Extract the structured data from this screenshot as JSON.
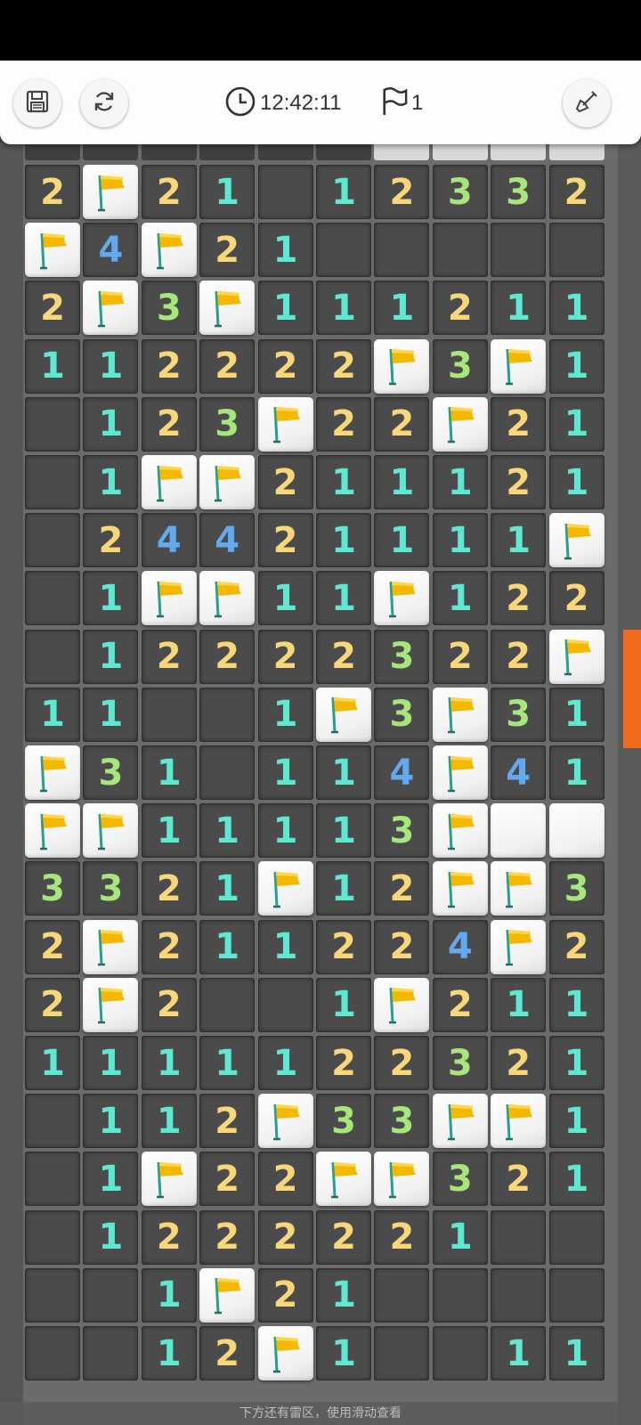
{
  "toolbar": {
    "timer": "12:42:11",
    "flag_count": "1",
    "icons": [
      "save-icon",
      "refresh-icon",
      "clock-icon",
      "flag-outline-icon",
      "shovel-icon"
    ]
  },
  "hint": "下方还有雷区，使用滑动查看",
  "colors": {
    "n1": "#5ee8d2",
    "n2": "#f7d77a",
    "n3": "#a6e67a",
    "n4": "#63a9ee",
    "flag": "#f5b800",
    "scroll_thumb": "#f26b1d"
  },
  "partial_row": [
    "o",
    "o",
    "o",
    "o",
    "o",
    "o",
    "h",
    "h",
    "h",
    "h"
  ],
  "board": [
    [
      "2",
      "F",
      "2",
      "1",
      "",
      "1",
      "2",
      "3",
      "3",
      "2"
    ],
    [
      "F",
      "4",
      "F",
      "2",
      "1",
      "",
      "",
      "",
      "",
      ""
    ],
    [
      "2",
      "F",
      "3",
      "F",
      "1",
      "1",
      "1",
      "2",
      "1",
      "1"
    ],
    [
      "1",
      "1",
      "2",
      "2",
      "2",
      "2",
      "F",
      "3",
      "F",
      "1"
    ],
    [
      "",
      "1",
      "2",
      "3",
      "F",
      "2",
      "2",
      "F",
      "2",
      "1"
    ],
    [
      "",
      "1",
      "F",
      "F",
      "2",
      "1",
      "1",
      "1",
      "2",
      "1"
    ],
    [
      "",
      "2",
      "4",
      "4",
      "2",
      "1",
      "1",
      "1",
      "1",
      "F"
    ],
    [
      "",
      "1",
      "F",
      "F",
      "1",
      "1",
      "F",
      "1",
      "2",
      "2"
    ],
    [
      "",
      "1",
      "2",
      "2",
      "2",
      "2",
      "3",
      "2",
      "2",
      "F"
    ],
    [
      "1",
      "1",
      "",
      "",
      "1",
      "F",
      "3",
      "F",
      "3",
      "1"
    ],
    [
      "F",
      "3",
      "1",
      "",
      "1",
      "1",
      "4",
      "F",
      "4",
      "1"
    ],
    [
      "F",
      "F",
      "1",
      "1",
      "1",
      "1",
      "3",
      "F",
      "H",
      "H"
    ],
    [
      "3",
      "3",
      "2",
      "1",
      "F",
      "1",
      "2",
      "F",
      "F",
      "3"
    ],
    [
      "2",
      "F",
      "2",
      "1",
      "1",
      "2",
      "2",
      "4",
      "F",
      "2"
    ],
    [
      "2",
      "F",
      "2",
      "",
      "",
      "1",
      "F",
      "2",
      "1",
      "1"
    ],
    [
      "1",
      "1",
      "1",
      "1",
      "1",
      "2",
      "2",
      "3",
      "2",
      "1"
    ],
    [
      "",
      "1",
      "1",
      "2",
      "F",
      "3",
      "3",
      "F",
      "F",
      "1"
    ],
    [
      "",
      "1",
      "F",
      "2",
      "2",
      "F",
      "F",
      "3",
      "2",
      "1"
    ],
    [
      "",
      "1",
      "2",
      "2",
      "2",
      "2",
      "2",
      "1",
      "",
      ""
    ],
    [
      "",
      "",
      "1",
      "F",
      "2",
      "1",
      "",
      "",
      "",
      ""
    ],
    [
      "",
      "",
      "1",
      "2",
      "F",
      "1",
      "",
      "",
      "1",
      "1"
    ]
  ],
  "scroll": {
    "thumb_start": 0.38,
    "thumb_size": 0.092
  }
}
